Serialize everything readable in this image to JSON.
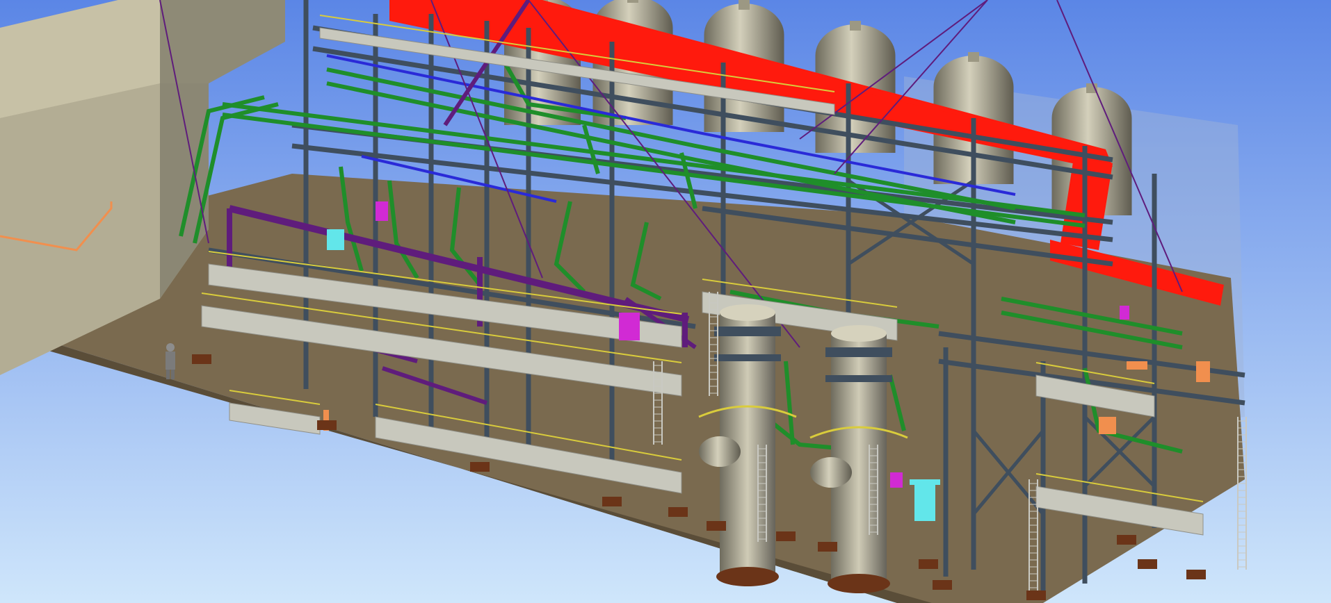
{
  "scene": {
    "type": "3d-plant-model-render",
    "colors": {
      "sky_top": "#5b86e6",
      "sky_bottom": "#cfe6fb",
      "ground": "#7a6a4f",
      "building": "#b3ad94",
      "steel": "#3f4e5e",
      "grating": "#c8c8bd",
      "handrail": "#d9cc3c",
      "green_pipe": "#1f8e2a",
      "red_duct": "#ff1a0d",
      "blue_pipe": "#2a2ad8",
      "purple_brace": "#5f1c7c",
      "vessel": "#a8a48c",
      "cyan_equipment": "#62e6ea",
      "orange_pipe": "#f18f4e",
      "magenta_valve": "#d12ad4"
    },
    "icons": [
      "vessel-icon",
      "column-icon",
      "ladder-icon",
      "human-figure-icon"
    ]
  }
}
